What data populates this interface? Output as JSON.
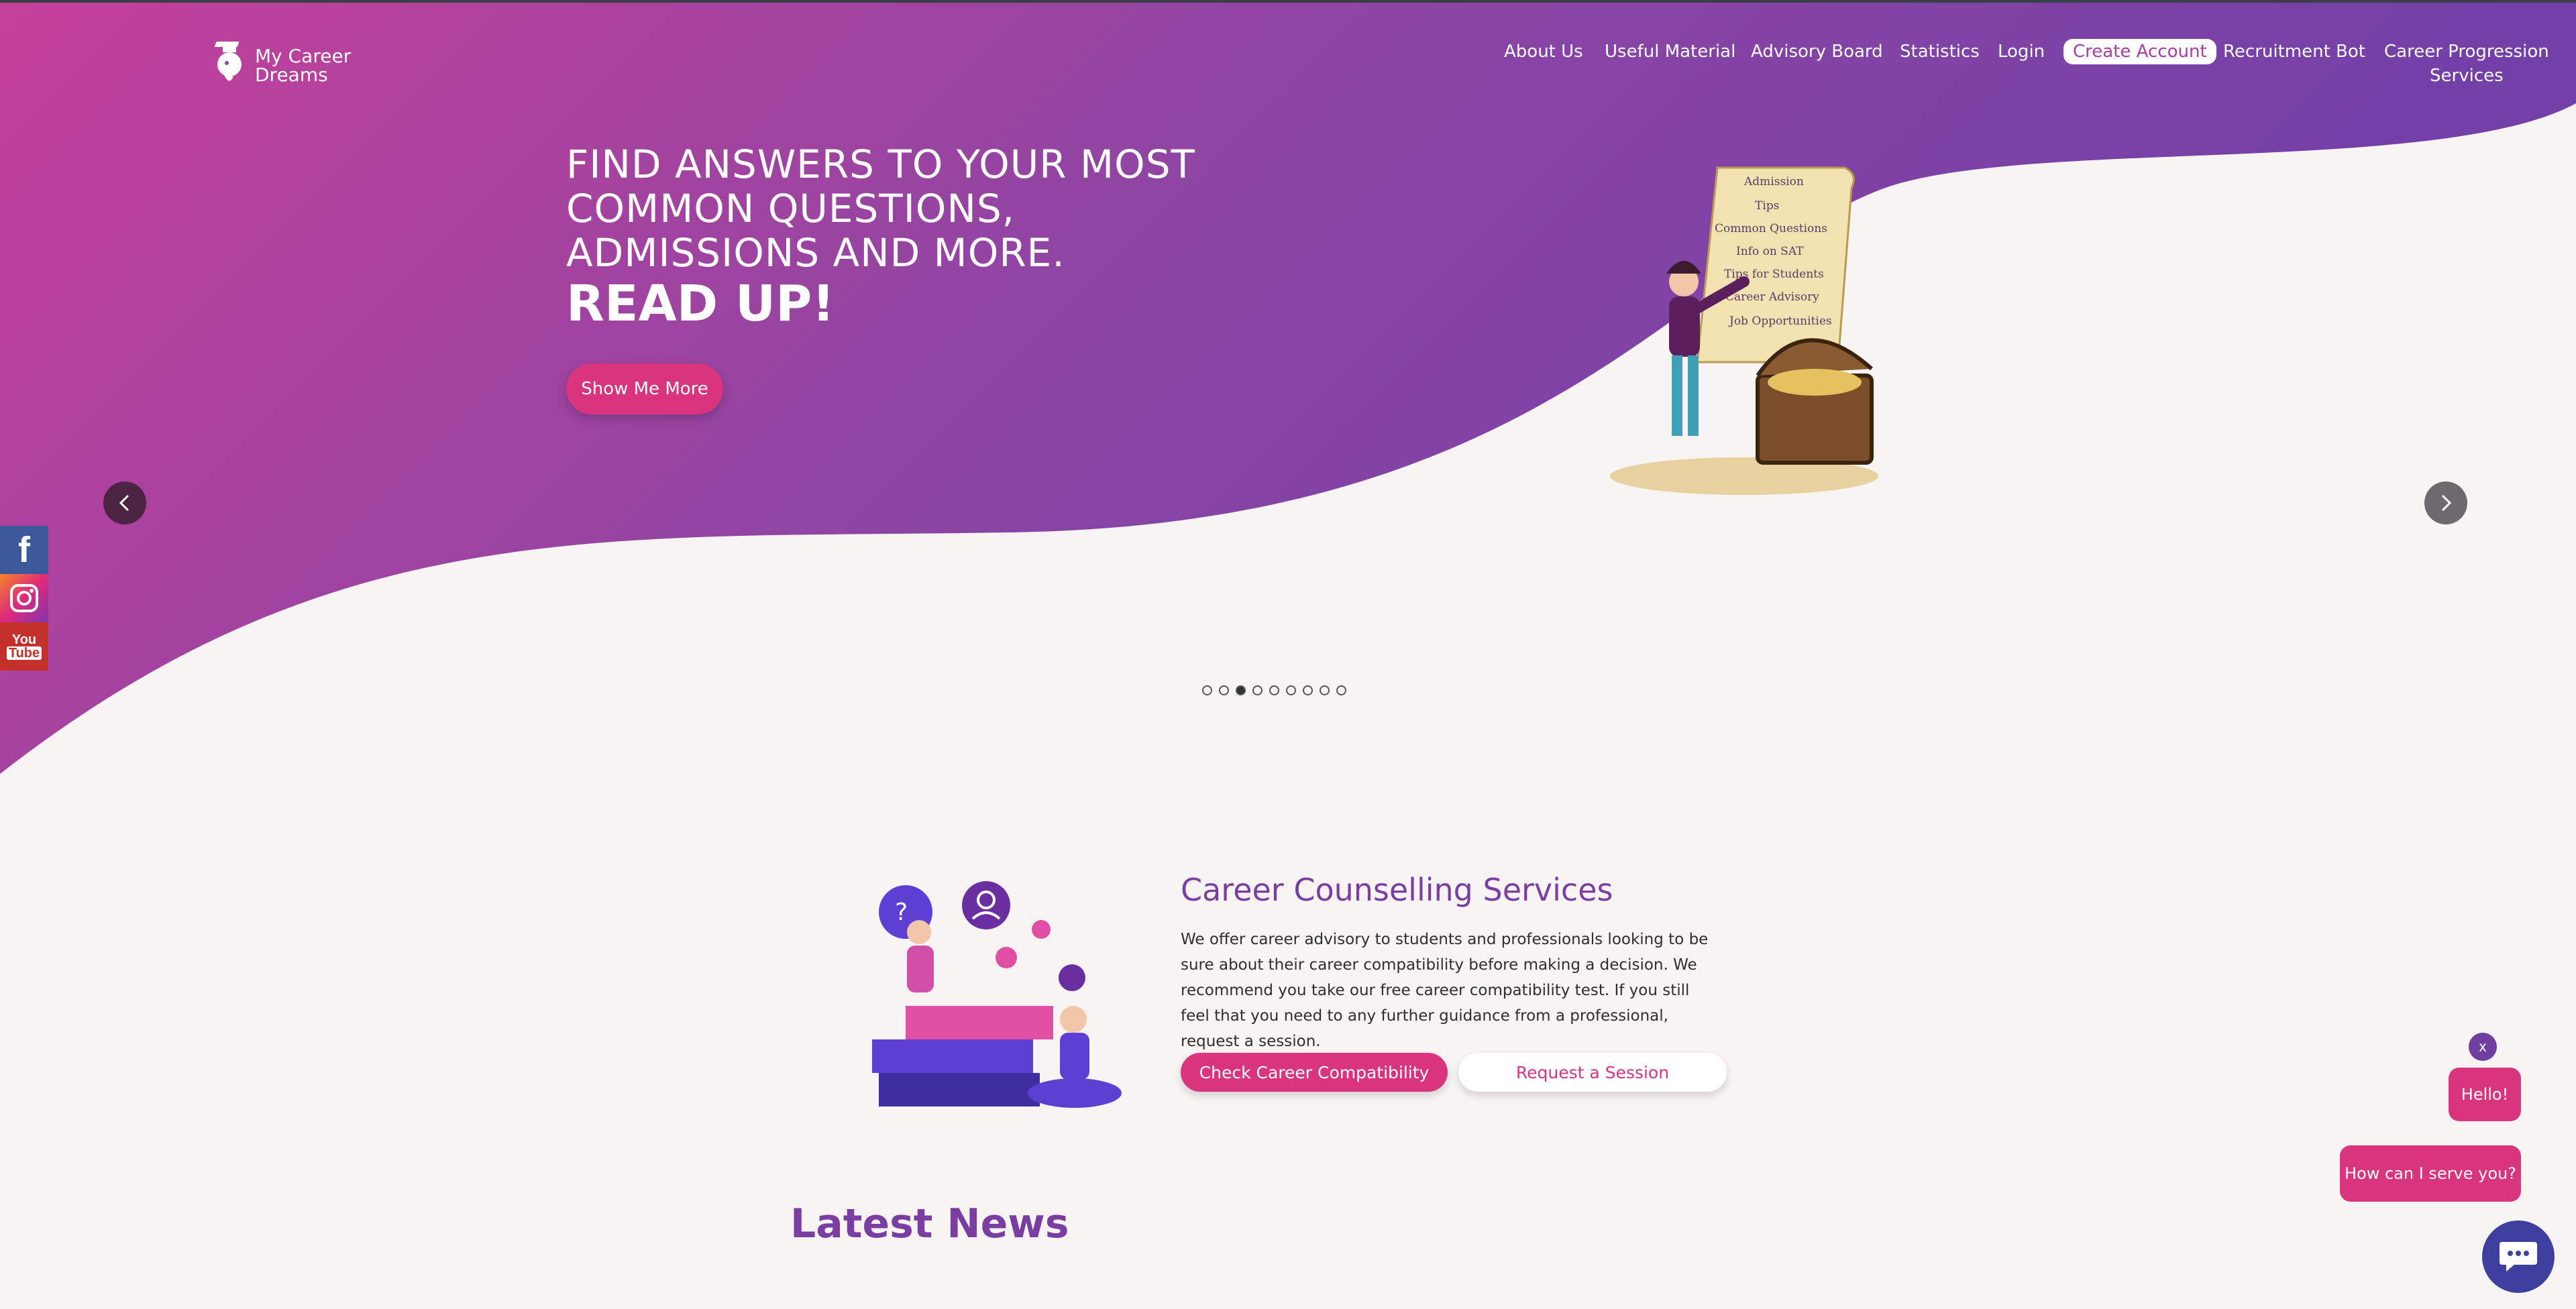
{
  "brand": {
    "name_line1": "My Career",
    "name_line2": "Dreams"
  },
  "nav": {
    "about": "About Us",
    "material": "Useful Material",
    "advisory": "Advisory Board",
    "statistics": "Statistics",
    "login": "Login",
    "create_account": "Create Account",
    "recruitment": "Recruitment Bot",
    "career_line1": "Career Progression",
    "career_line2": "Services"
  },
  "hero": {
    "line1": "FIND ANSWERS TO YOUR MOST",
    "line2": "COMMON QUESTIONS,",
    "line3": "ADMISSIONS AND MORE.",
    "strong": "READ UP!",
    "button": "Show Me More",
    "scroll_items": [
      "Admission",
      "Tips",
      "Common Questions",
      "Info on SAT",
      "Tips for Students",
      "Career Advisory",
      "Job Opportunities"
    ],
    "slide_count": 9,
    "active_slide": 3
  },
  "counselling": {
    "title": "Career Counselling Services",
    "description": "We offer career advisory to students and professionals looking to be sure about their career compatibility before making a decision. We recommend you take our free career compatibility test. If you still feel that you need to any further guidance from a professional, request a session.",
    "check_btn": "Check Career Compatibility",
    "request_btn": "Request a Session"
  },
  "news": {
    "title": "Latest News"
  },
  "chat": {
    "close": "x",
    "hello": "Hello!",
    "serve": "How can I serve you?"
  },
  "social": {
    "facebook": "f",
    "youtube_1": "You",
    "youtube_2": "Tube"
  },
  "colors": {
    "primary": "#d8357e",
    "purple": "#7a3ea3",
    "hero_start": "#c5409a",
    "hero_end": "#6e3fa8"
  }
}
